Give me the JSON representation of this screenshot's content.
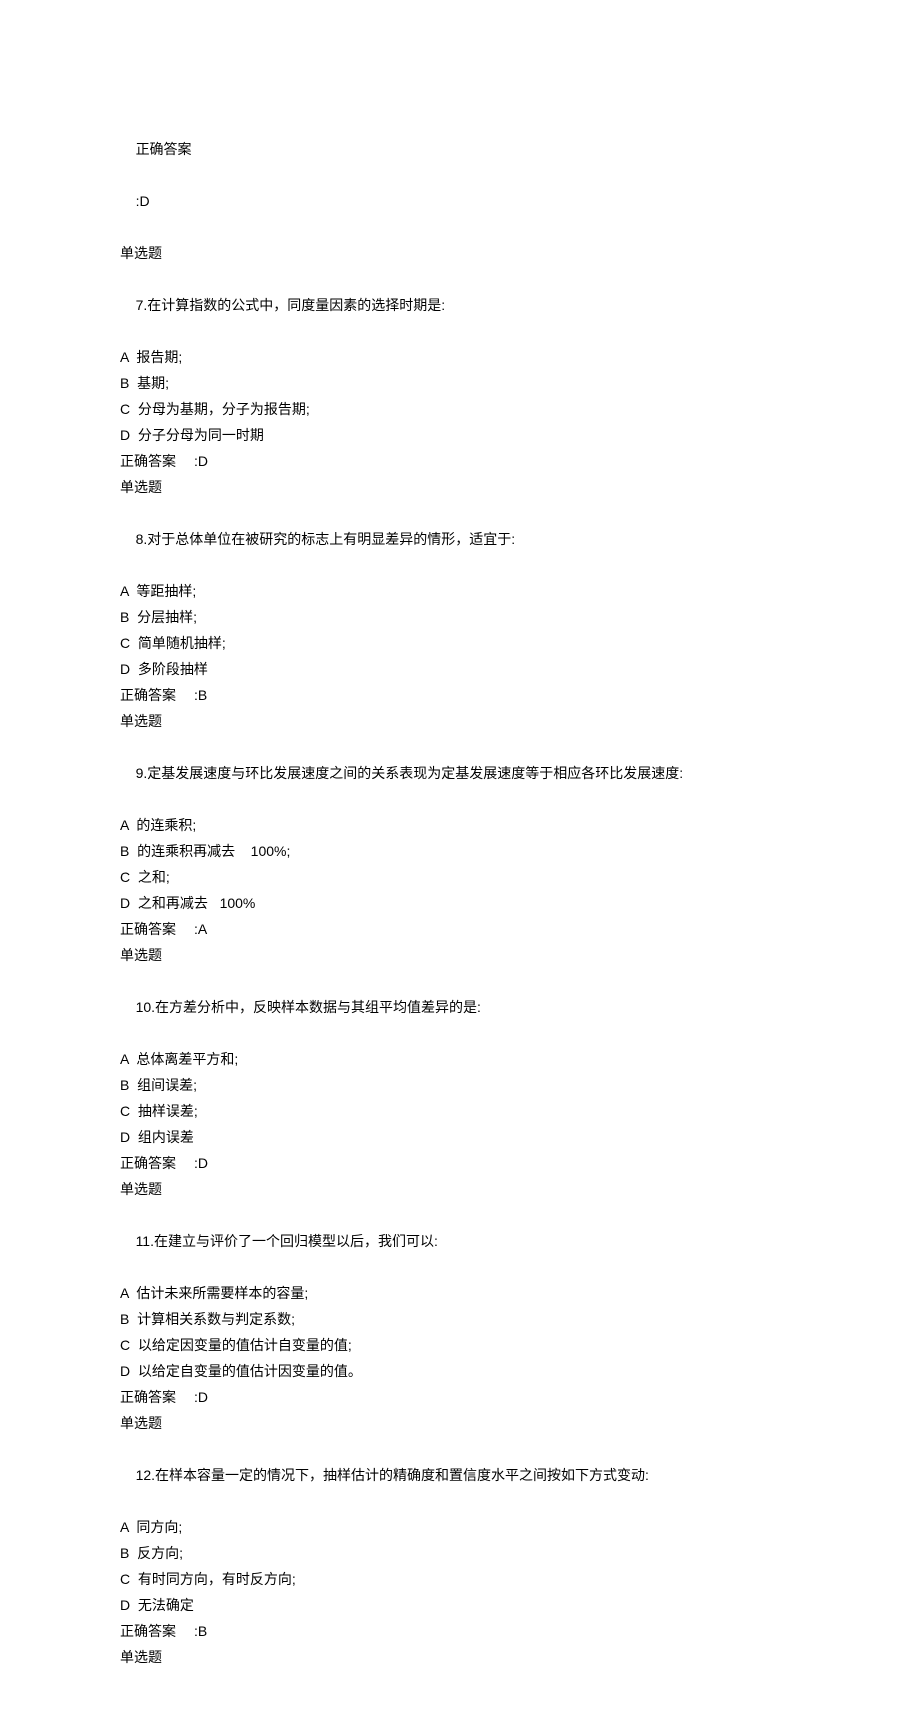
{
  "preamble": {
    "answer_label": "正确答案",
    "answer_value": ":D",
    "qtype": "单选题"
  },
  "questions": [
    {
      "number": "7.",
      "stem": "在计算指数的公式中，同度量因素的选择时期是:",
      "options": [
        {
          "letter": "A",
          "text": "报告期;"
        },
        {
          "letter": "B",
          "text": "基期;"
        },
        {
          "letter": "C",
          "text": "分母为基期，分子为报告期;"
        },
        {
          "letter": "D",
          "text": "分子分母为同一时期"
        }
      ],
      "answer_label": "正确答案",
      "answer_value": ":D",
      "qtype": "单选题"
    },
    {
      "number": "8.",
      "stem": "对于总体单位在被研究的标志上有明显差异的情形，适宜于:",
      "options": [
        {
          "letter": "A",
          "text": "等距抽样;"
        },
        {
          "letter": "B",
          "text": "分层抽样;"
        },
        {
          "letter": "C",
          "text": "简单随机抽样;"
        },
        {
          "letter": "D",
          "text": "多阶段抽样"
        }
      ],
      "answer_label": "正确答案",
      "answer_value": ":B",
      "qtype": "单选题"
    },
    {
      "number": "9.",
      "stem": "定基发展速度与环比发展速度之间的关系表现为定基发展速度等于相应各环比发展速度:",
      "options": [
        {
          "letter": "A",
          "text": "的连乘积;"
        },
        {
          "letter": "B",
          "text": "的连乘积再减去    100%;"
        },
        {
          "letter": "C",
          "text": "之和;"
        },
        {
          "letter": "D",
          "text": "之和再减去   100%"
        }
      ],
      "answer_label": "正确答案",
      "answer_value": ":A",
      "qtype": "单选题"
    },
    {
      "number": "10.",
      "stem": "在方差分析中，反映样本数据与其组平均值差异的是:",
      "options": [
        {
          "letter": "A",
          "text": "总体离差平方和;"
        },
        {
          "letter": "B",
          "text": "组间误差;"
        },
        {
          "letter": "C",
          "text": "抽样误差;"
        },
        {
          "letter": "D",
          "text": "组内误差"
        }
      ],
      "answer_label": "正确答案",
      "answer_value": ":D",
      "qtype": "单选题"
    },
    {
      "number": "11.",
      "stem": "在建立与评价了一个回归模型以后，我们可以:",
      "options": [
        {
          "letter": "A",
          "text": "估计未来所需要样本的容量;"
        },
        {
          "letter": "B",
          "text": "计算相关系数与判定系数;"
        },
        {
          "letter": "C",
          "text": "以给定因变量的值估计自变量的值;"
        },
        {
          "letter": "D",
          "text": "以给定自变量的值估计因变量的值。"
        }
      ],
      "answer_label": "正确答案",
      "answer_value": ":D",
      "qtype": "单选题"
    },
    {
      "number": "12.",
      "stem": "在样本容量一定的情况下，抽样估计的精确度和置信度水平之间按如下方式变动:",
      "options": [
        {
          "letter": "A",
          "text": "同方向;"
        },
        {
          "letter": "B",
          "text": "反方向;"
        },
        {
          "letter": "C",
          "text": "有时同方向，有时反方向;"
        },
        {
          "letter": "D",
          "text": "无法确定"
        }
      ],
      "answer_label": "正确答案",
      "answer_value": ":B",
      "qtype": "单选题"
    }
  ]
}
